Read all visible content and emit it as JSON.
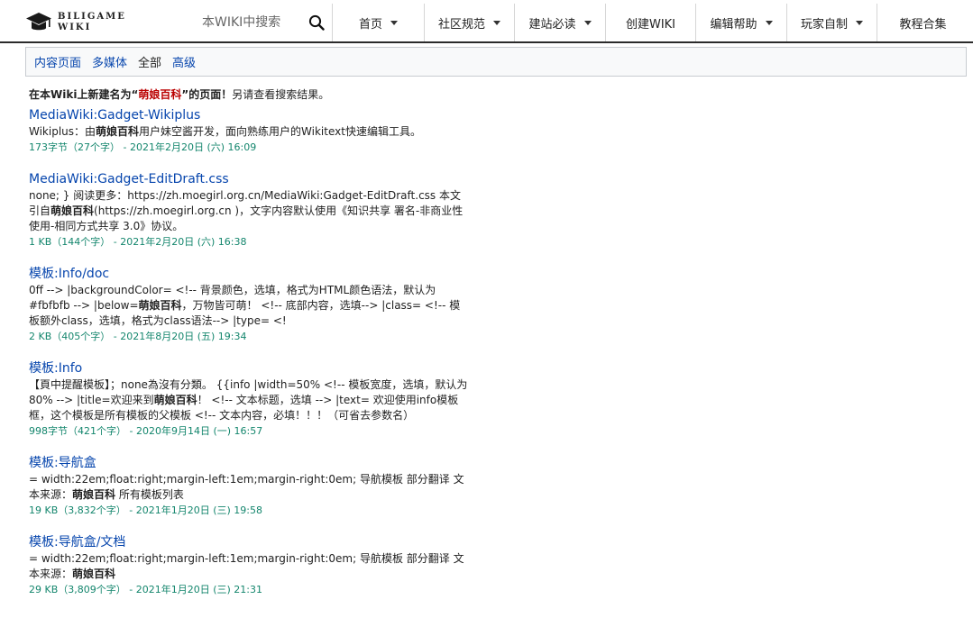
{
  "header": {
    "logo_line1": "BILIGAME",
    "logo_line2": "WIKI",
    "search_placeholder": "本WIKI中搜索",
    "nav": [
      {
        "label": "首页",
        "dropdown": true
      },
      {
        "label": "社区规范",
        "dropdown": true
      },
      {
        "label": "建站必读",
        "dropdown": true
      },
      {
        "label": "创建WIKI",
        "dropdown": false
      },
      {
        "label": "编辑帮助",
        "dropdown": true
      },
      {
        "label": "玩家自制",
        "dropdown": true
      },
      {
        "label": "教程合集",
        "dropdown": false
      }
    ]
  },
  "subbar": {
    "links": [
      "内容页面",
      "多媒体",
      "全部",
      "高级"
    ],
    "active": "全部"
  },
  "notice": {
    "prefix": "在本Wiki上新建名为“",
    "term": "萌娘百科",
    "suffix": "”的页面！",
    "extra": "另请查看搜索结果。"
  },
  "results": [
    {
      "title": "MediaWiki:Gadget-Wikiplus",
      "snippet": [
        "Wikiplus：由",
        {
          "b": "萌娘百科"
        },
        "用户妹空酱开发，面向熟练用户的Wikitext快速编辑工具。"
      ],
      "meta": "173字节（27个字） - 2021年2月20日 (六) 16:09"
    },
    {
      "title": "MediaWiki:Gadget-EditDraft.css",
      "snippet": [
        "none; } 阅读更多：https://zh.moegirl.org.cn/MediaWiki:Gadget-EditDraft.css 本文引自",
        {
          "b": "萌娘百科"
        },
        "(https://zh.moegirl.org.cn )，文字内容默认使用《知识共享 署名-非商业性使用-相同方式共享 3.0》协议。"
      ],
      "meta": "1 KB（144个字） - 2021年2月20日 (六) 16:38"
    },
    {
      "title": "模板:Info/doc",
      "snippet": [
        "0ff --> |backgroundColor= <!-- 背景颜色，选填，格式为HTML颜色语法，默认为 #fbfbfb --> |below=",
        {
          "b": "萌娘百科"
        },
        "，万物皆可萌！ <!-- 底部内容，选填--> |class= <!-- 模板额外class，选填，格式为class语法--> |type= <!"
      ],
      "meta": "2 KB（405个字） - 2021年8月20日 (五) 19:34"
    },
    {
      "title": "模板:Info",
      "snippet": [
        "【頁中提醒模板】；none為沒有分類。 {{info |width=50% <!-- 模板宽度，选填，默认为80% --> |title=欢迎来到",
        {
          "b": "萌娘百科"
        },
        "！ <!-- 文本标题，选填 --> |text= 欢迎使用info模板框，这个模板是所有模板的父模板 <!-- 文本内容，必填！！！（可省去参数名）"
      ],
      "meta": "998字节（421个字） - 2020年9月14日 (一) 16:57"
    },
    {
      "title": "模板:导航盒",
      "snippet": [
        "= width:22em;float:right;margin-left:1em;margin-right:0em; 导航模板 部分翻译 文本来源：",
        {
          "b": "萌娘百科"
        },
        " 所有模板列表"
      ],
      "meta": "19 KB（3,832个字） - 2021年1月20日 (三) 19:58"
    },
    {
      "title": "模板:导航盒/文档",
      "snippet": [
        "= width:22em;float:right;margin-left:1em;margin-right:0em; 导航模板 部分翻译 文本来源：",
        {
          "b": "萌娘百科"
        }
      ],
      "meta": "29 KB（3,809个字） - 2021年1月20日 (三) 21:31"
    }
  ]
}
